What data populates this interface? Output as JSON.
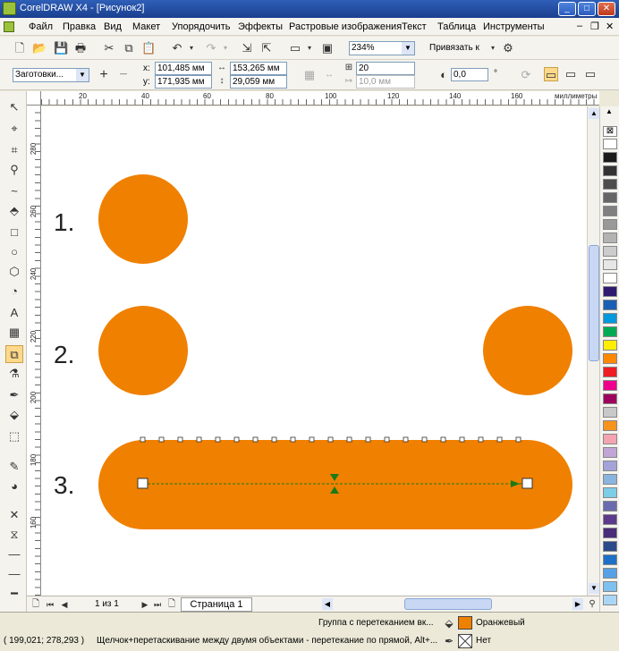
{
  "window": {
    "title": "CorelDRAW X4 - [Рисунок2]",
    "minimize": "_",
    "maximize": "□",
    "close": "✕"
  },
  "menu": [
    "Файл",
    "Правка",
    "Вид",
    "Макет",
    "Упорядочить",
    "Эффекты",
    "Растровые изображения",
    "Текст",
    "Таблица",
    "Инструменты"
  ],
  "menu_controls": {
    "minimize": "–",
    "restore": "❐",
    "close": "✕"
  },
  "toolbar": {
    "zoom": "234%",
    "snap_label": "Привязать к"
  },
  "propbar": {
    "preset": "Заготовки...",
    "x_label": "x:",
    "x": "101,485 мм",
    "y_label": "y:",
    "y": "171,935 мм",
    "width": "153,265 мм",
    "height": "29,059 мм",
    "steps": "20",
    "offset": "10,0 мм",
    "rotation": "0,0",
    "degree": "°"
  },
  "ruler": {
    "unit": "миллиметры",
    "h_ticks": [
      "20",
      "40",
      "60",
      "80",
      "100",
      "120",
      "140",
      "160"
    ],
    "v_ticks": [
      "280",
      "260",
      "240",
      "220",
      "200",
      "180",
      "160"
    ]
  },
  "canvas": {
    "labels": [
      "1.",
      "2.",
      "3."
    ],
    "fill": "#f08000"
  },
  "pagebar": {
    "page_count": "1 из 1",
    "page_tab": "Страница 1"
  },
  "status": {
    "object_info": "Группа с перетеканием вк...",
    "fill_name": "Оранжевый",
    "outline_name": "Нет",
    "coords": "( 199,021; 278,293 )",
    "hint": "Щелчок+перетаскивание между двумя объектами - перетекание по прямой, Alt+..."
  },
  "palette": [
    "#ffffff",
    "#1a1a1a",
    "#333333",
    "#4d4d4d",
    "#666666",
    "#808080",
    "#999999",
    "#b3b3b3",
    "#cccccc",
    "#e6e6e6",
    "#ffffff",
    "#2e1a6e",
    "#1a5fb4",
    "#0099dd",
    "#00aa55",
    "#ffee00",
    "#ff8800",
    "#ee1c24",
    "#ec008c",
    "#9e005d",
    "#c8c8c8",
    "#f7941d",
    "#f4a4b0",
    "#c1a5d6",
    "#a3a3d9",
    "#8ab4e0",
    "#7ccde8",
    "#6a6ab0",
    "#5e3a8a",
    "#4b2c7a",
    "#2a4a8a",
    "#1e6fc8",
    "#55a0e6",
    "#7ec0f0",
    "#aad6f5"
  ]
}
